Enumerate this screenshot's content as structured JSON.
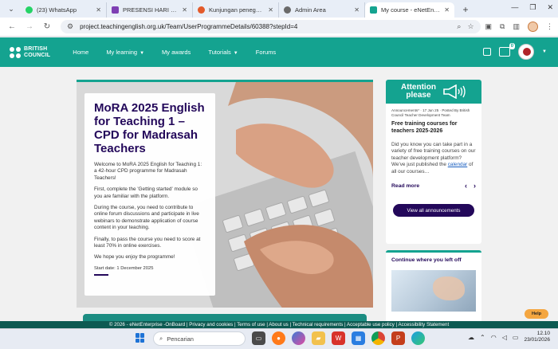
{
  "browser": {
    "tabs": [
      {
        "title": "(23) WhatsApp",
        "favicon_color": "#25d366",
        "active": false
      },
      {
        "title": "PRESENSI HARI KEDUA W",
        "favicon_color": "#7e3fb3",
        "active": false
      },
      {
        "title": "Kunjungan penegak pane",
        "favicon_color": "#e35a2a",
        "active": false
      },
      {
        "title": "Admin Area",
        "favicon_color": "#6a6a6a",
        "active": false
      },
      {
        "title": "My course - eNetEnterpri",
        "favicon_color": "#14a390",
        "active": true
      }
    ],
    "url": "project.teachingenglish.org.uk/Team/UserProgrammeDetails/60388?stepId=4"
  },
  "site": {
    "logo_line1": "BRITISH",
    "logo_line2": "COUNCIL",
    "nav": [
      "Home",
      "My learning",
      "My awards",
      "Tutorials",
      "Forums"
    ],
    "notification_count": "0",
    "brand_color": "#14a390",
    "accent_color": "#23085a"
  },
  "hero": {
    "title": "MoRA 2025 English for Teaching 1 – CPD for Madrasah Teachers",
    "paragraphs": [
      "Welcome to MoRA 2025 English for Teaching 1: a 42-hour CPD programme for Madrasah Teachers!",
      "First, complete the 'Getting started' module so you are familiar with the platform.",
      "During the course, you need to contribute to online forum discussions and participate in live webinars to demonstrate application of course content in your teaching.",
      "Finally, to pass the course you need to score at least 70% in online exercises.",
      "We hope you enjoy the programme!"
    ],
    "start_date": "Start date: 1 December 2025"
  },
  "attention": {
    "title_line1": "Attention",
    "title_line2": "please",
    "meta": "Announcements* · 17 Jun 25 · Posted By British Council Teacher Development Team",
    "headline": "Free training courses for teachers 2025-2026",
    "text_before_link": "Did you know you can take part in a variety of free training courses on our teacher development platform?  We've just published the ",
    "link_text": "calendar",
    "text_after_link": " of all our courses…",
    "read_more": "Read more",
    "all_button": "View all announcements"
  },
  "continue": {
    "title": "Continue where you left off"
  },
  "footer": "© 2026 - eNetEnterprise -OnBoard | Privacy and cookies | Terms of use | About us | Technical requirements | Acceptable use policy | Accessibility Statement",
  "help_label": "Help",
  "taskbar": {
    "search_placeholder": "Pencarian",
    "time": "12.10",
    "date": "23/01/2026"
  }
}
